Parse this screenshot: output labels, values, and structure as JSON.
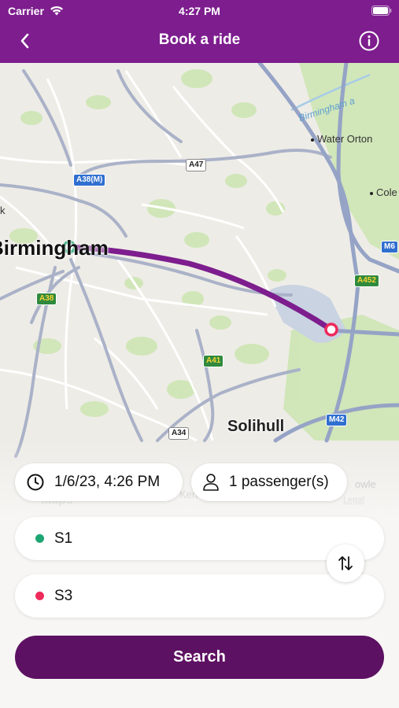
{
  "status_bar": {
    "carrier": "Carrier",
    "time": "4:27 PM"
  },
  "nav": {
    "title": "Book a ride",
    "back_icon": "chevron-left-icon",
    "info_icon": "info-circle-icon"
  },
  "map": {
    "places": {
      "birmingham": "Birmingham",
      "solihull": "Solihull",
      "water_orton": "Water Orton",
      "coleshill": "Cole",
      "k": "k",
      "knowle": "owle",
      "kenilworth_fragment": "Ken"
    },
    "waterway": "Birmingham a",
    "roads": [
      "A47",
      "A38(M)",
      "A38",
      "A41",
      "A34",
      "M6",
      "A452",
      "M42"
    ],
    "attribution": "Maps",
    "legal": "Legal",
    "route_color": "#7d1d8e",
    "origin_color": "#1ea672",
    "destination_color": "#ee2a5b"
  },
  "trip": {
    "datetime": "1/6/23, 4:26 PM",
    "datetime_icon": "clock-icon",
    "passengers": "1 passenger(s)",
    "passengers_icon": "person-icon",
    "origin": "S1",
    "destination": "S3",
    "swap_icon": "swap-vertical-icon"
  },
  "actions": {
    "search_label": "Search"
  },
  "colors": {
    "brand": "#7d1d8e",
    "button": "#5d1162"
  }
}
